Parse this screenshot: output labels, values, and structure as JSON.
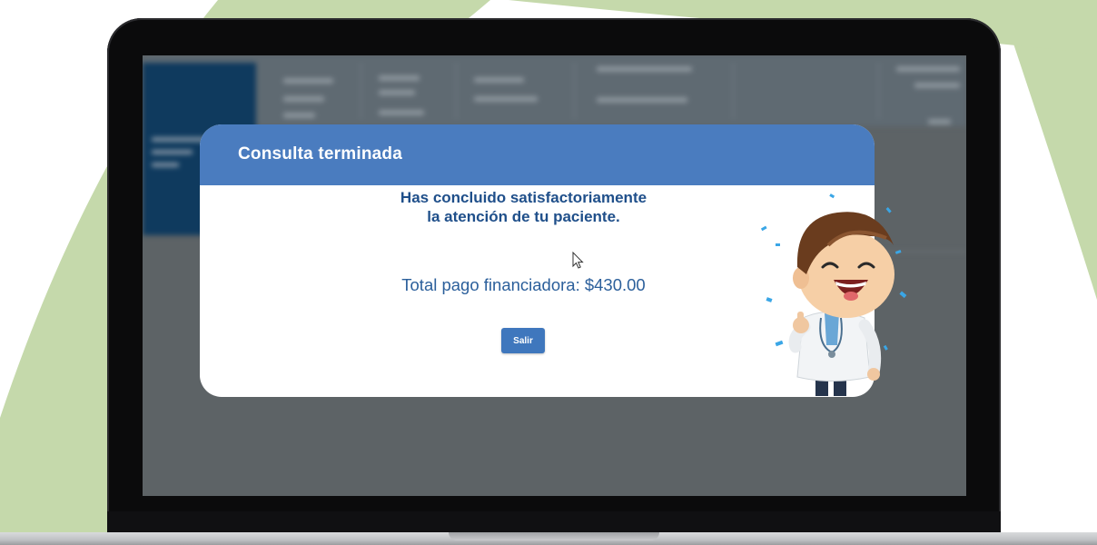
{
  "colors": {
    "accent": "#4a7cbf",
    "button": "#3f77bd",
    "message_text": "#1f4f8a",
    "background_shape": "#c5d9ab"
  },
  "modal": {
    "title": "Consulta terminada",
    "message_line1": "Has concluido satisfactoriamente",
    "message_line2": "la atención de tu paciente.",
    "total_label": "Total pago financiadora: $430.00",
    "exit_label": "Salir"
  },
  "icons": {
    "cursor": "arrow-cursor-icon",
    "mascot": "doctor-mascot-thumbs-up",
    "confetti": "confetti-icon"
  }
}
